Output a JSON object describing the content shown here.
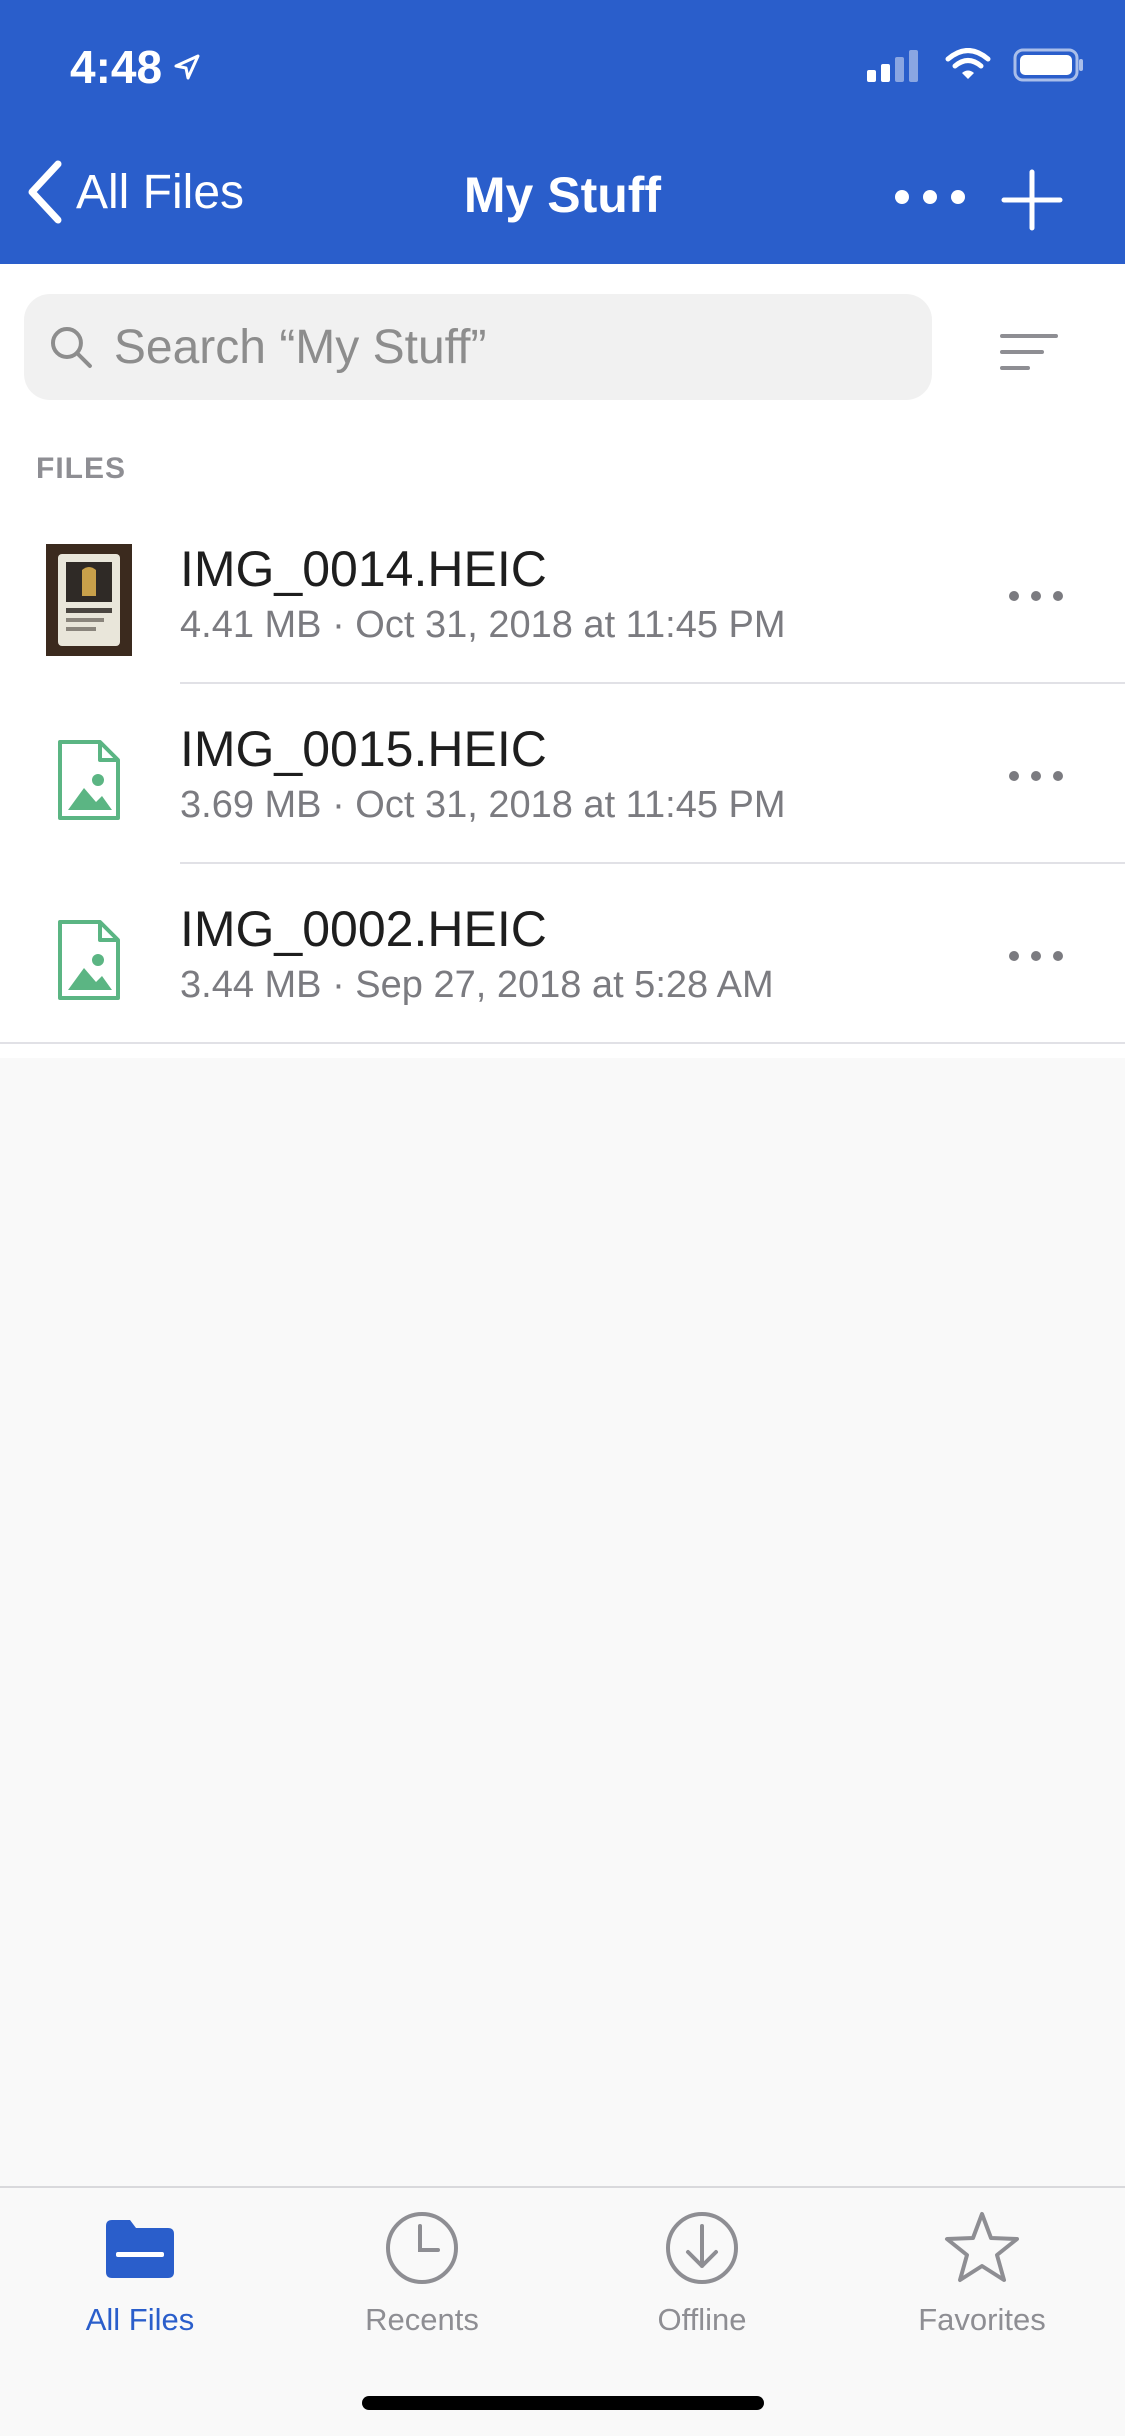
{
  "status_bar": {
    "time": "4:48"
  },
  "nav": {
    "back_label": "All Files",
    "title": "My Stuff"
  },
  "search": {
    "placeholder": "Search “My Stuff”"
  },
  "section_label": "FILES",
  "files": [
    {
      "name": "IMG_0014.HEIC",
      "meta": "4.41 MB · Oct 31, 2018 at 11:45 PM",
      "icon": "photo-thumbnail"
    },
    {
      "name": "IMG_0015.HEIC",
      "meta": "3.69 MB · Oct 31, 2018 at 11:45 PM",
      "icon": "image-file-icon"
    },
    {
      "name": "IMG_0002.HEIC",
      "meta": "3.44 MB · Sep 27, 2018 at 5:28 AM",
      "icon": "image-file-icon"
    }
  ],
  "tabs": [
    {
      "label": "All Files",
      "icon": "folder-icon",
      "active": true
    },
    {
      "label": "Recents",
      "icon": "clock-icon",
      "active": false
    },
    {
      "label": "Offline",
      "icon": "download-icon",
      "active": false
    },
    {
      "label": "Favorites",
      "icon": "star-icon",
      "active": false
    }
  ],
  "colors": {
    "header": "#2a5ecb",
    "accent": "#2a5ecb",
    "file_icon": "#5bb583",
    "inactive": "#8e8e93"
  }
}
